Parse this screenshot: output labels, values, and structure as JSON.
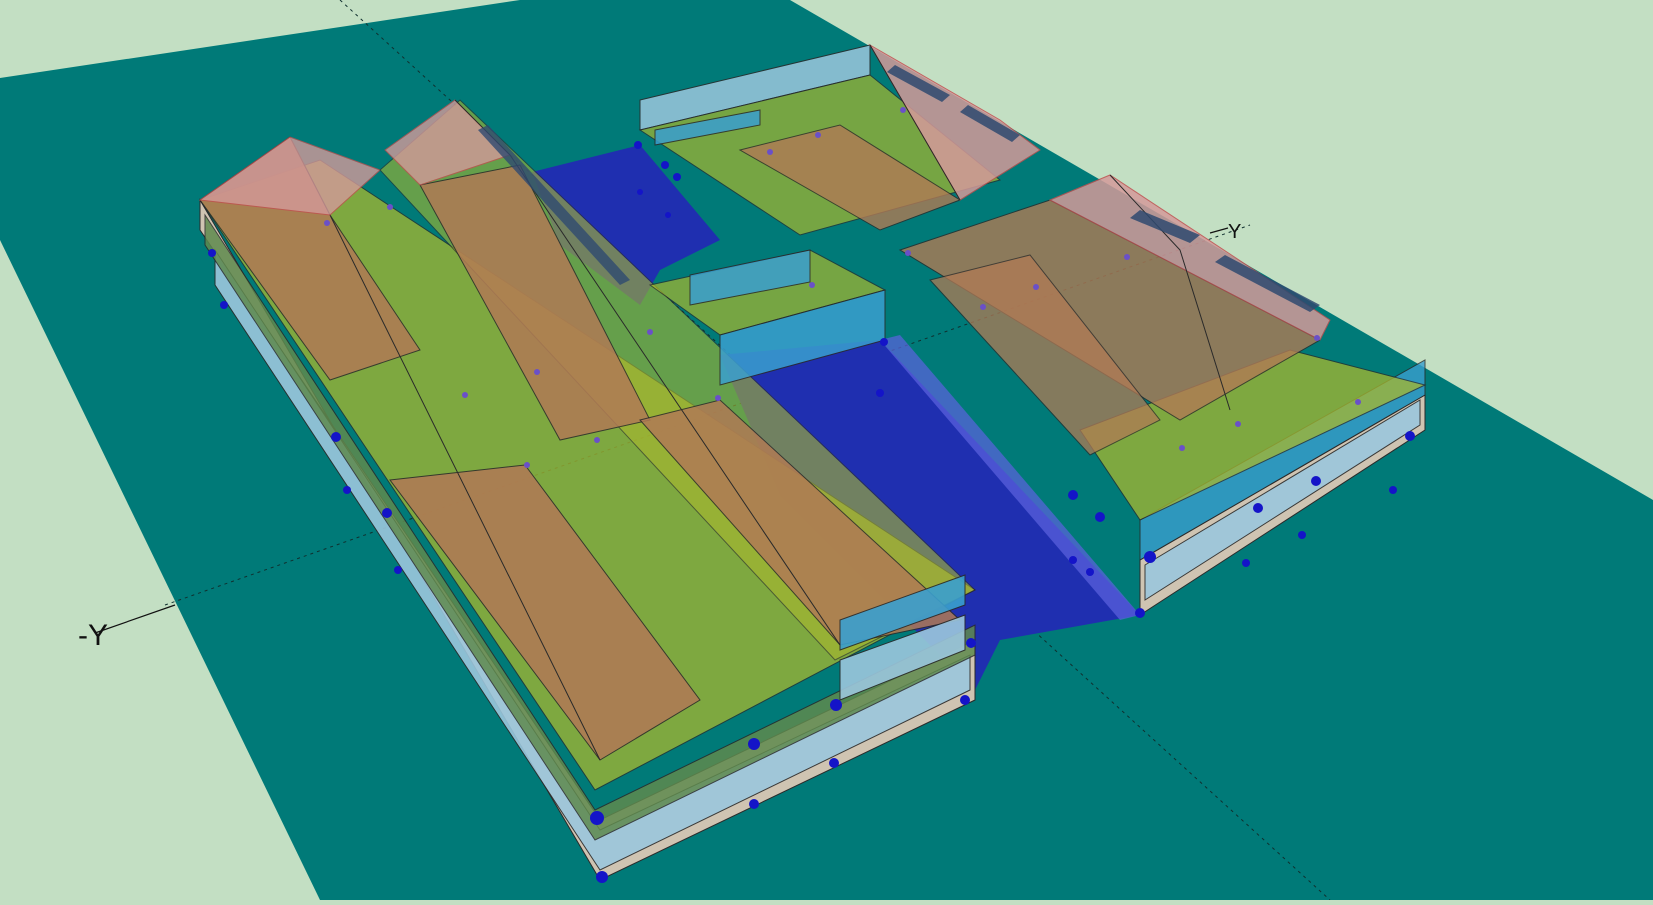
{
  "viewport": {
    "background_color": "#c3dfc3",
    "ground_color": "#007a78",
    "axis_labels": {
      "negative_y": "-Y",
      "positive_y": "Y"
    }
  },
  "colors": {
    "roof_orange": "#b07a55",
    "roof_pink": "#d49a9a",
    "floor_yellow": "#a8b82e",
    "wall_green": "#5f8a4e",
    "wall_blue": "#3a9fcf",
    "wall_light_blue": "#9cc7dd",
    "slab_beige": "#cfc4b2",
    "void_blue": "#1f2fb0",
    "vertex_blue": "#1414c8",
    "edge_dark": "#2a2a2a",
    "edge_red": "#c05050"
  }
}
